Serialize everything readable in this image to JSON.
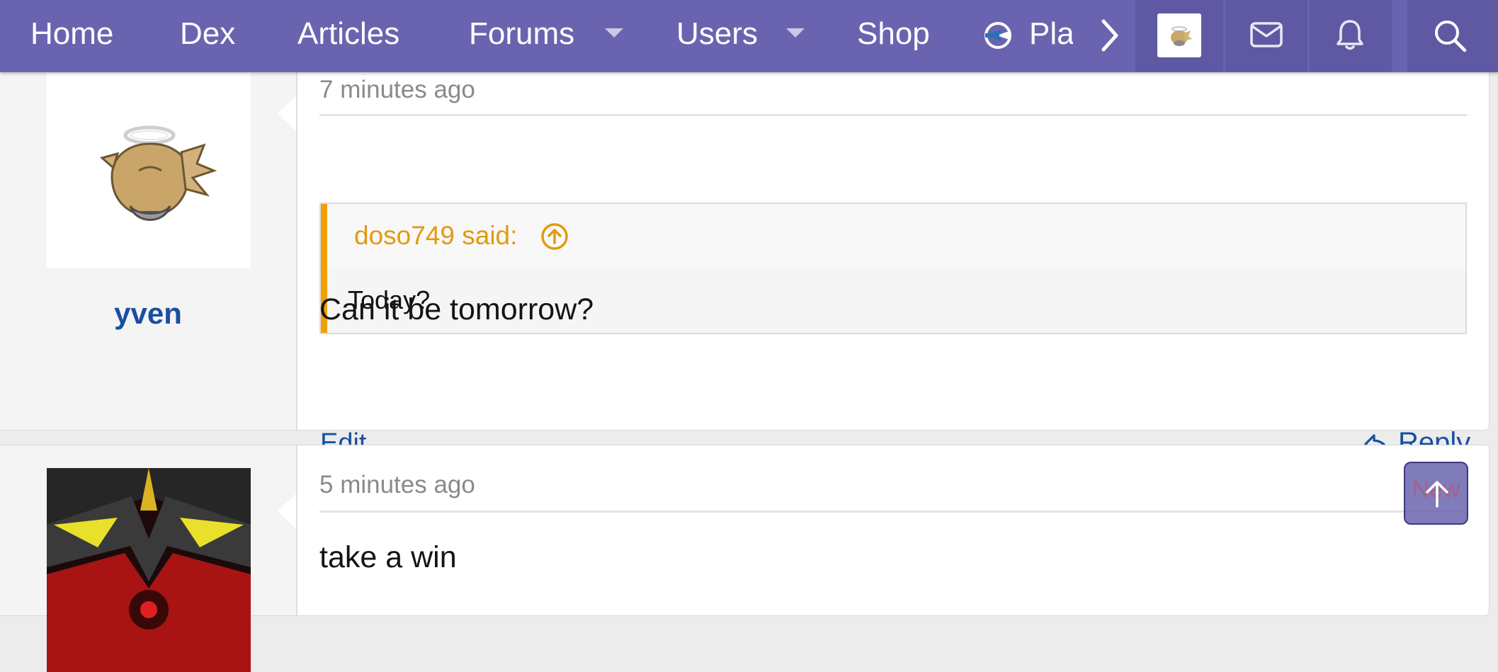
{
  "nav": {
    "items": [
      "Home",
      "Dex",
      "Articles",
      "Forums",
      "Users",
      "Shop"
    ],
    "play_label": "Play"
  },
  "posts": [
    {
      "timestamp": "7 minutes ago",
      "author": "yven",
      "quote": {
        "author": "doso749 said:",
        "text": "Today?"
      },
      "text": "Can it be tomorrow?",
      "edit_label": "Edit",
      "reply_label": "Reply"
    },
    {
      "timestamp": "5 minutes ago",
      "text": "take a win",
      "badge": "New"
    }
  ],
  "colors": {
    "nav": "#6a64b0",
    "link": "#1a4fa0",
    "quote_accent": "#f0a000"
  }
}
